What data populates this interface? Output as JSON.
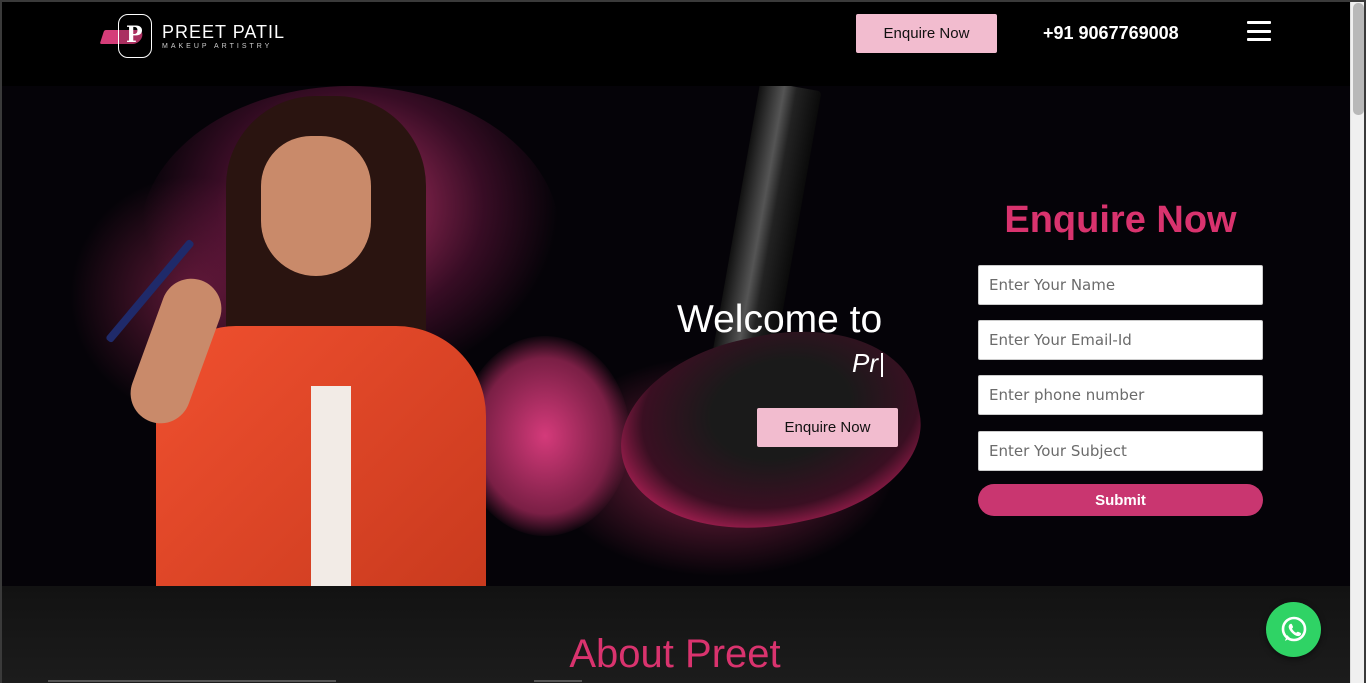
{
  "header": {
    "logo": {
      "name": "PREET PATIL",
      "subtitle": "MAKEUP ARTISTRY",
      "letter": "P"
    },
    "enquire_label": "Enquire Now",
    "phone": "+91 9067769008"
  },
  "hero": {
    "welcome": "Welcome to",
    "typed_text": "Pr",
    "enquire_label": "Enquire Now"
  },
  "form": {
    "title": "Enquire Now",
    "name_placeholder": "Enter Your Name",
    "email_placeholder": "Enter Your Email-Id",
    "phone_placeholder": "Enter phone number",
    "subject_placeholder": "Enter Your Subject",
    "submit_label": "Submit"
  },
  "about": {
    "title": "About Preet"
  },
  "colors": {
    "accent": "#d9336e",
    "button_pink": "#f2bccf",
    "submit": "#c93670",
    "whatsapp": "#2fd365"
  }
}
